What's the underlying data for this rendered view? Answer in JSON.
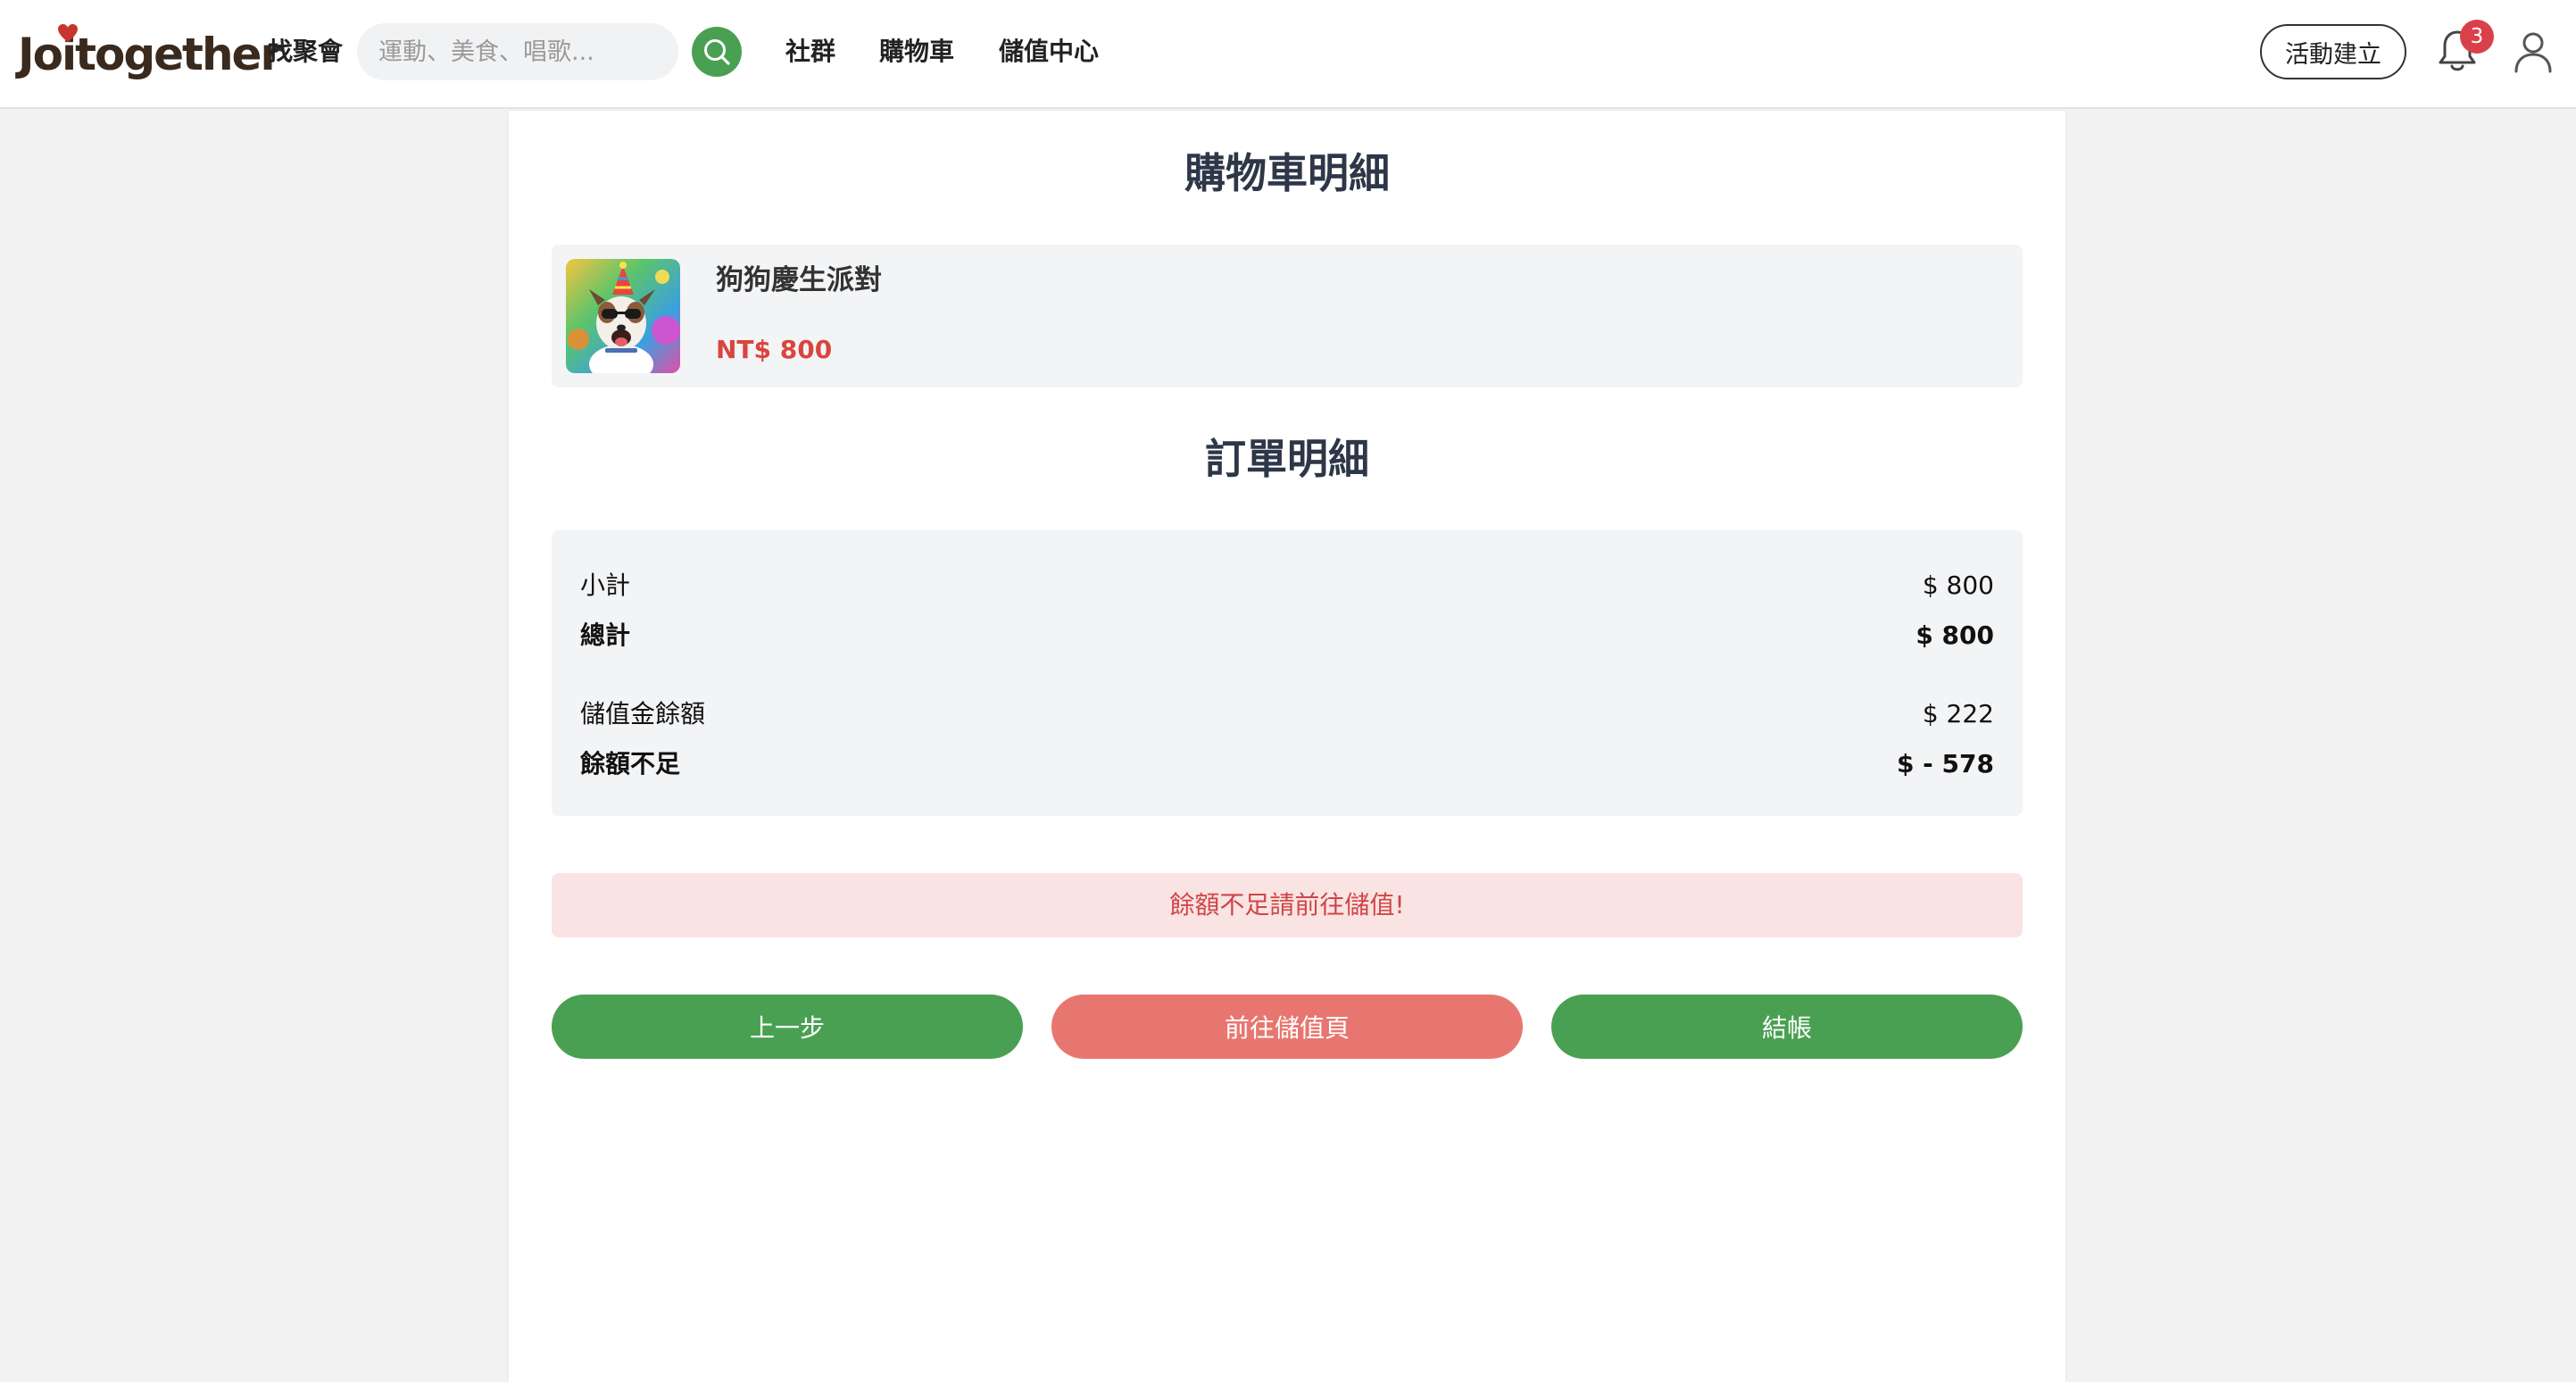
{
  "header": {
    "logo_text": "Joitogether",
    "find_label": "找聚會",
    "search_placeholder": "運動、美食、唱歌...",
    "nav": [
      {
        "label": "社群"
      },
      {
        "label": "購物車"
      },
      {
        "label": "儲值中心"
      }
    ],
    "create_label": "活動建立",
    "notification_count": "3",
    "icons": [
      "search-icon",
      "bell-icon",
      "user-icon",
      "heart-icon"
    ]
  },
  "cart": {
    "title": "購物車明細",
    "items": [
      {
        "name": "狗狗慶生派對",
        "price": "NT$ 800",
        "image_icon": "party-dog-photo"
      }
    ]
  },
  "order": {
    "title": "訂單明細",
    "rows": [
      {
        "label": "小計",
        "value": "$ 800",
        "bold": false
      },
      {
        "label": "總計",
        "value": "$ 800",
        "bold": true
      },
      {
        "label": "儲值金餘額",
        "value": "$ 222",
        "bold": false
      },
      {
        "label": "餘額不足",
        "value": "$ - 578",
        "bold": true
      }
    ]
  },
  "alert": {
    "message": "餘額不足請前往儲值!"
  },
  "actions": {
    "back_label": "上一步",
    "topup_label": "前往儲值頁",
    "checkout_label": "結帳"
  },
  "colors": {
    "brand_green": "#4aa052",
    "danger_red": "#d9453e",
    "soft_red_button": "#e87670",
    "alert_bg": "#f9e3e3",
    "badge_red": "#d9414a",
    "panel_gray": "#f3f4f6"
  }
}
